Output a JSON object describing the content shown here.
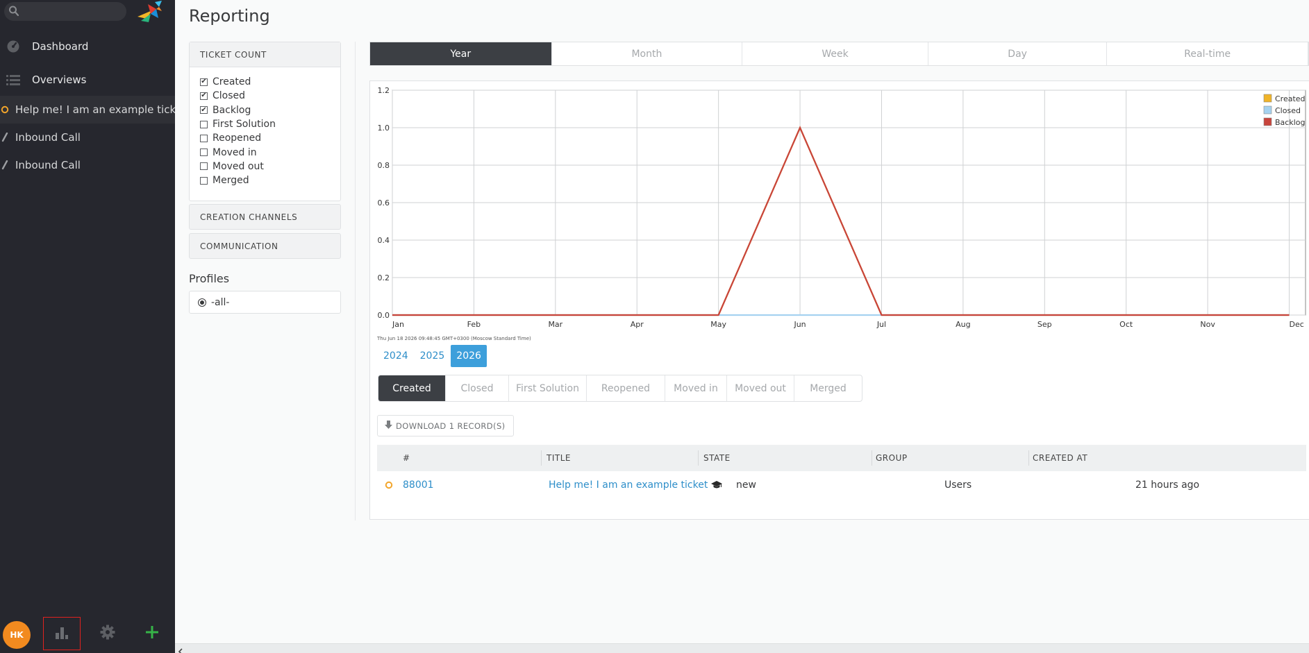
{
  "sidebar": {
    "search": {
      "placeholder": "",
      "value": ""
    },
    "nav": [
      {
        "label": "Dashboard",
        "icon": "dashboard-icon"
      },
      {
        "label": "Overviews",
        "icon": "overviews-icon"
      }
    ],
    "tasks": [
      {
        "label": "Help me! I am an example ticket...",
        "icon": "ticket-status-circle-icon"
      },
      {
        "label": "Inbound Call",
        "icon": "pencil-icon"
      },
      {
        "label": "Inbound Call",
        "icon": "pencil-icon"
      }
    ],
    "avatar_initials": "HK",
    "bottom_buttons": [
      "reporting-icon",
      "settings-gear-icon",
      "plus-icon"
    ]
  },
  "page": {
    "title": "Reporting"
  },
  "filters": {
    "ticket_count": {
      "heading": "TICKET COUNT",
      "items": [
        {
          "label": "Created",
          "checked": true
        },
        {
          "label": "Closed",
          "checked": true
        },
        {
          "label": "Backlog",
          "checked": true
        },
        {
          "label": "First Solution",
          "checked": false
        },
        {
          "label": "Reopened",
          "checked": false
        },
        {
          "label": "Moved in",
          "checked": false
        },
        {
          "label": "Moved out",
          "checked": false
        },
        {
          "label": "Merged",
          "checked": false
        }
      ]
    },
    "creation_channels": "CREATION CHANNELS",
    "communication": "COMMUNICATION",
    "profiles_title": "Profiles",
    "profile_selected": "-all-"
  },
  "period_tabs": {
    "items": [
      "Year",
      "Month",
      "Week",
      "Day",
      "Real-time"
    ],
    "active": "Year"
  },
  "chart_data": {
    "type": "line",
    "categories": [
      "Jan",
      "Feb",
      "Mar",
      "Apr",
      "May",
      "Jun",
      "Jul",
      "Aug",
      "Sep",
      "Oct",
      "Nov",
      "Dec"
    ],
    "yticks": [
      "0.0",
      "0.2",
      "0.4",
      "0.6",
      "0.8",
      "1.0",
      "1.2"
    ],
    "ylim": [
      0,
      1.2
    ],
    "grid": true,
    "legend_position": "top-right",
    "series": [
      {
        "name": "Created",
        "color": "#f0b428",
        "values": [
          0,
          0,
          0,
          0,
          0,
          1,
          0,
          0,
          0,
          0,
          0,
          0
        ]
      },
      {
        "name": "Closed",
        "color": "#a5d2f0",
        "values": [
          0,
          0,
          0,
          0,
          0,
          0,
          0,
          0,
          0,
          0,
          0,
          0
        ]
      },
      {
        "name": "Backlog",
        "color": "#c8443c",
        "values": [
          0,
          0,
          0,
          0,
          0,
          1,
          0,
          0,
          0,
          0,
          0,
          0
        ]
      }
    ],
    "footnote": "Thu Jun 18 2026 09:48:45 GMT+0300 (Moscow Standard Time)"
  },
  "years": {
    "items": [
      "2024",
      "2025",
      "2026"
    ],
    "active": "2026"
  },
  "metric_tabs": {
    "items": [
      "Created",
      "Closed",
      "First Solution",
      "Reopened",
      "Moved in",
      "Moved out",
      "Merged"
    ],
    "active": "Created"
  },
  "download_label": "DOWNLOAD 1 RECORD(S)",
  "table": {
    "headers": [
      "#",
      "TITLE",
      "STATE",
      "GROUP",
      "CREATED AT"
    ],
    "rows": [
      {
        "number": "88001",
        "title": "Help me! I am an example ticket",
        "title_icon": "graduation-cap-icon",
        "state": "new",
        "group": "Users",
        "created_at": "21 hours ago"
      }
    ]
  },
  "colors": {
    "sidebar_bg": "#26272e",
    "accent_blue": "#3d9fdb",
    "active_tab": "#3c3f44",
    "new_ticket_orange": "#f2a52b",
    "add_green": "#36b348"
  }
}
